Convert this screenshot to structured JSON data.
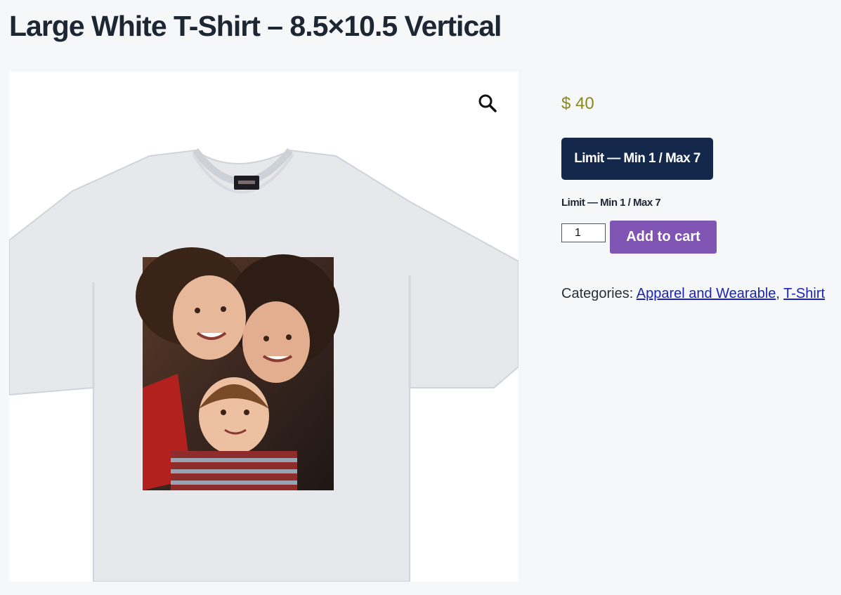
{
  "product": {
    "title": "Large White T-Shirt – 8.5×10.5 Vertical",
    "price": "$ 40",
    "limit_badge": "Limit — Min 1 / Max 7",
    "limit_text": "Limit — Min 1 / Max 7",
    "quantity": "1",
    "add_to_cart_label": "Add to cart",
    "categories_label": "Categories:",
    "categories": [
      "Apparel and Wearable",
      "T-Shirt"
    ],
    "category_separator": ", "
  },
  "gallery": {
    "zoom_icon": "magnifier-icon"
  },
  "colors": {
    "page_bg": "#f6f7f9",
    "price": "#8a8a1c",
    "badge_bg": "#13284a",
    "add_to_cart_bg": "#7f54b3",
    "link": "#1a23b8"
  }
}
